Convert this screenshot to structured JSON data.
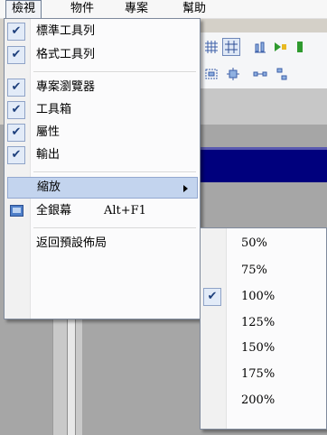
{
  "menubar": {
    "items": [
      "檢視",
      "物件",
      "專案",
      "幫助"
    ]
  },
  "view_menu": {
    "items": [
      {
        "label": "標準工具列",
        "checked": true
      },
      {
        "label": "格式工具列",
        "checked": true
      },
      {
        "label": "專案瀏覽器",
        "checked": true
      },
      {
        "label": "工具箱",
        "checked": true
      },
      {
        "label": "屬性",
        "checked": true
      },
      {
        "label": "輸出",
        "checked": true
      },
      {
        "label": "縮放",
        "submenu": true,
        "highlighted": true
      },
      {
        "label": "全銀幕",
        "shortcut": "Alt+F1",
        "icon": "fullscreen-icon"
      },
      {
        "label": "返回預設佈局"
      }
    ]
  },
  "zoom_submenu": {
    "items": [
      "50%",
      "75%",
      "100%",
      "125%",
      "150%",
      "175%",
      "200%"
    ],
    "selected": "100%"
  },
  "colors": {
    "accent_highlight": "#c3d4ee",
    "check_bg": "#e2ebf8",
    "document_title_bar": "#00007d"
  }
}
